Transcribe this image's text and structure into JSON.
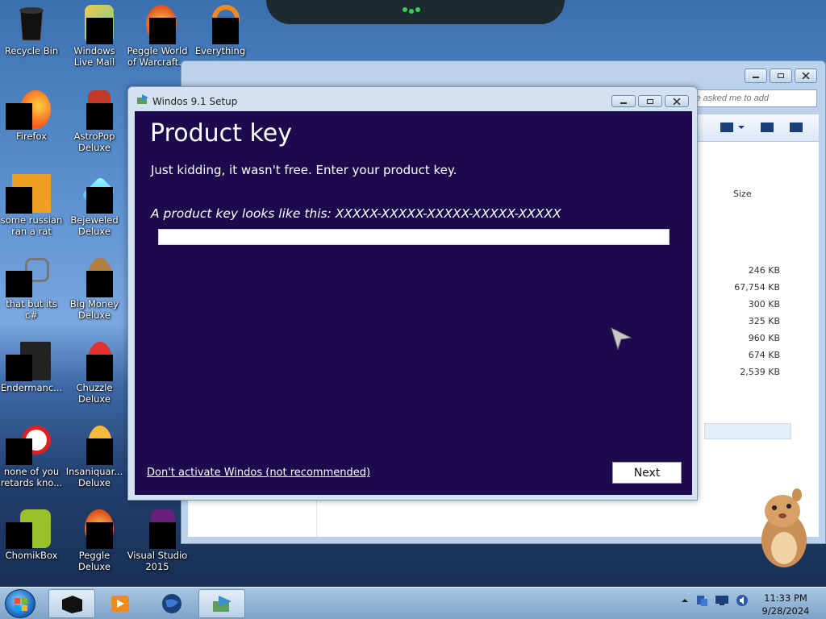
{
  "desktop": {
    "icons": [
      {
        "label": "Recycle Bin"
      },
      {
        "label": "Windows Live Mail"
      },
      {
        "label": "Peggle World of Warcraft..."
      },
      {
        "label": "Everything"
      },
      {
        "label": "Firefox"
      },
      {
        "label": "AstroPop Deluxe"
      },
      {
        "label": "some russian ran a rat"
      },
      {
        "label": "Bejeweled Deluxe"
      },
      {
        "label": "that but its c#"
      },
      {
        "label": "Big Money Deluxe"
      },
      {
        "label": "Endermanc..."
      },
      {
        "label": "Chuzzle Deluxe"
      },
      {
        "label": "none of you retards kno..."
      },
      {
        "label": "Insaniquar... Deluxe"
      },
      {
        "label": "ChomikBox"
      },
      {
        "label": "Peggle Deluxe"
      },
      {
        "label": "Visual Studio 2015"
      }
    ]
  },
  "explorer": {
    "search_placeholder": "le asked me to add",
    "size_header": "Size",
    "sizes": [
      "246 KB",
      "67,754 KB",
      "300 KB",
      "325 KB",
      "960 KB",
      "674 KB",
      "2,539 KB"
    ]
  },
  "setup": {
    "window_title": "Windos 9.1 Setup",
    "heading": "Product key",
    "subtitle": "Just kidding, it wasn't free. Enter your product key.",
    "hint": "A product key looks like this: XXXXX-XXXXX-XXXXX-XXXXX-XXXXX",
    "product_key_value": "",
    "skip_link": "Don't activate Windos (not recommended)",
    "next_label": "Next",
    "colors": {
      "panel_bg": "#1c0a4c",
      "text": "#ffffff"
    }
  },
  "taskbar": {
    "time": "11:33 PM",
    "date": "9/28/2024"
  }
}
